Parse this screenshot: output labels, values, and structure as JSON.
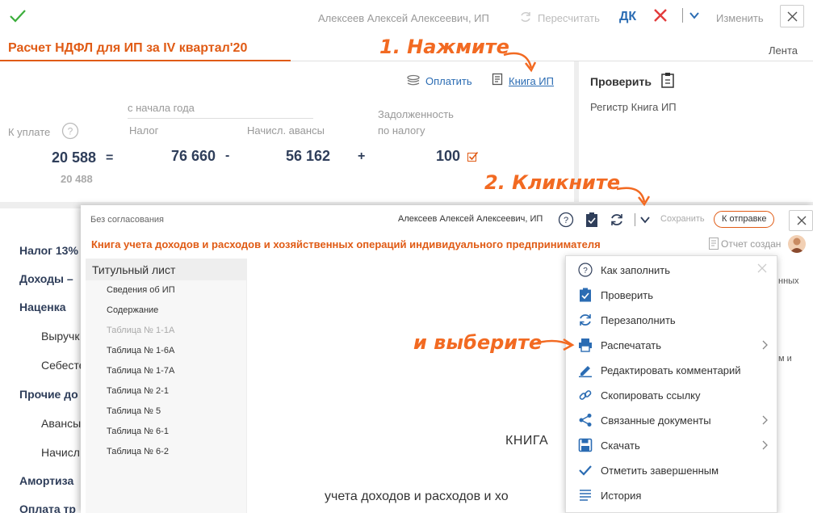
{
  "topbar": {
    "user": "Алексеев Алексей Алексеевич, ИП",
    "recalc": "Пересчитать",
    "dk": "ДК",
    "edit": "Изменить"
  },
  "doc": {
    "title": "Расчет НДФЛ для ИП за IV квартал'20",
    "lenta": "Лента"
  },
  "annotations": {
    "step1": "1. Нажмите",
    "step2": "2. Кликните",
    "step3": "и выберите"
  },
  "summary": {
    "pay_link": "Оплатить",
    "book_link": "Книга ИП",
    "check_label": "Проверить",
    "register": "Регистр Книга ИП",
    "since_year": "с начала года",
    "to_pay_label": "К уплате",
    "tax_label": "Налог",
    "advances_label": "Начисл. авансы",
    "debt_label_1": "Задолженность",
    "debt_label_2": "по налогу",
    "to_pay_value": "20 588",
    "to_pay_sub": "20 488",
    "tax_value": "76 660",
    "advances_value": "56 162",
    "debt_value": "100",
    "op_eq": "=",
    "op_minus": "-",
    "op_plus": "+"
  },
  "background_list": {
    "items": [
      "Налог 13%",
      "Доходы –",
      "Наценка",
      "Выручк",
      "Себесте",
      "Прочие до",
      "Авансы",
      "Начисл",
      "Амортиза",
      "Оплата тр"
    ],
    "right_1": "нных",
    "right_2": "м и"
  },
  "panel": {
    "no_coord": "Без согласования",
    "user": "Алексеев Алексей Алексеевич, ИП",
    "save": "Сохранить",
    "send": "К отправке",
    "title": "Книга учета доходов и расходов и хозяйственных операций индивидуального предпринимателя",
    "report": "Отчет создан",
    "sidebar_active": "Титульный лист",
    "sidebar_items": [
      "Сведения об ИП",
      "Содержание",
      "Таблица № 1-1А",
      "Таблица № 1-6А",
      "Таблица № 1-7А",
      "Таблица № 2-1",
      "Таблица № 5",
      "Таблица № 6-1",
      "Таблица № 6-2"
    ],
    "doc_heading": "КНИГА",
    "doc_sub": "учета доходов и расходов и хо"
  },
  "menu": {
    "items": [
      {
        "label": "Как заполнить",
        "icon": "help-circle-icon"
      },
      {
        "label": "Проверить",
        "icon": "clipboard-check-icon"
      },
      {
        "label": "Перезаполнить",
        "icon": "refresh-icon"
      },
      {
        "label": "Распечатать",
        "icon": "printer-icon"
      },
      {
        "label": "Редактировать комментарий",
        "icon": "pencil-icon"
      },
      {
        "label": "Скопировать ссылку",
        "icon": "link-icon"
      },
      {
        "label": "Связанные документы",
        "icon": "share-icon"
      },
      {
        "label": "Скачать",
        "icon": "save-icon"
      },
      {
        "label": "Отметить завершенным",
        "icon": "check-icon"
      },
      {
        "label": "История",
        "icon": "history-icon"
      }
    ]
  },
  "colors": {
    "accent": "#e05b15",
    "annotation": "#f26a22",
    "link": "#2b6cb3",
    "menu_icon": "#2b6cb3"
  }
}
